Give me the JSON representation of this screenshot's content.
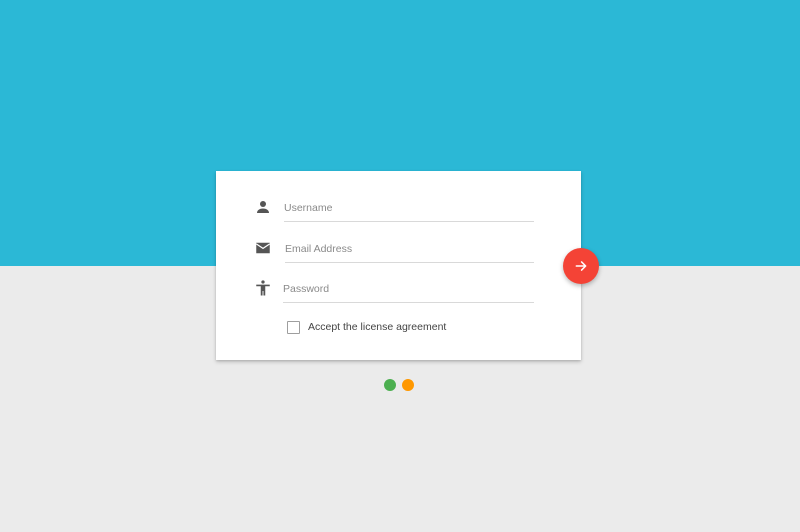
{
  "colors": {
    "top_band": "#2bb8d6",
    "background": "#ebebeb",
    "card": "#ffffff",
    "fab": "#f44336",
    "step_dot_1": "#4caf50",
    "step_dot_2": "#ff9800",
    "icon": "#555555"
  },
  "form": {
    "username": {
      "icon": "person-icon",
      "placeholder": "Username",
      "value": ""
    },
    "email": {
      "icon": "mail-icon",
      "placeholder": "Email Address",
      "value": ""
    },
    "password": {
      "icon": "accessibility-icon",
      "placeholder": "Password",
      "value": ""
    },
    "license": {
      "label": "Accept the license agreement",
      "checked": false
    }
  },
  "submit": {
    "icon": "arrow-right-icon"
  },
  "steps": {
    "count": 2,
    "items": [
      {
        "color": "#4caf50"
      },
      {
        "color": "#ff9800"
      }
    ]
  }
}
